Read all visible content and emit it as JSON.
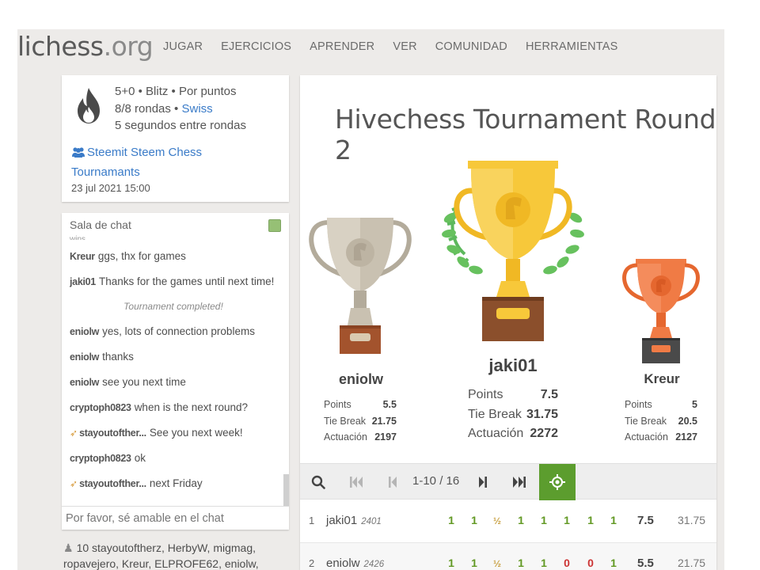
{
  "header": {
    "logo_main": "lichess",
    "logo_tld": ".org",
    "nav": [
      "JUGAR",
      "EJERCICIOS",
      "APRENDER",
      "VER",
      "COMUNIDAD",
      "HERRAMIENTAS"
    ]
  },
  "info": {
    "line1": "5+0 • Blitz • Por puntos",
    "line2_prefix": "8/8 rondas • ",
    "line2_link": "Swiss",
    "line3": "5 segundos entre rondas",
    "team": "Steemit Steem Chess Tournamants",
    "date": "23 jul 2021 15:00"
  },
  "chat": {
    "title": "Sala de chat",
    "cut_text": "wins",
    "messages": [
      {
        "user": "Kreur",
        "text": "ggs, thx for games"
      },
      {
        "user": "jaki01",
        "text": "Thanks for the games until next time!"
      },
      {
        "system": "Tournament completed!"
      },
      {
        "user": "eniolw",
        "text": "yes, lots of connection problems"
      },
      {
        "user": "eniolw",
        "text": "thanks"
      },
      {
        "user": "eniolw",
        "text": "see you next time"
      },
      {
        "user": "cryptoph0823",
        "text": "when is the next round?"
      },
      {
        "user": "stayoutofther...",
        "text": "See you next week!",
        "wing": true
      },
      {
        "user": "cryptoph0823",
        "text": "ok"
      },
      {
        "user": "stayoutofther...",
        "text": "next Friday",
        "wing": true
      }
    ],
    "placeholder": "Por favor, sé amable en el chat",
    "members_count": "10",
    "members": "stayoutoftherz, HerbyW, migmag, ropavejero, Kreur, ELPROFE62, eniolw,"
  },
  "tournament": {
    "title": "Hivechess Tournament Round 2",
    "podium": [
      {
        "place": 2,
        "name": "eniolw",
        "points": "5.5",
        "tiebreak": "21.75",
        "performance": "2197"
      },
      {
        "place": 1,
        "name": "jaki01",
        "points": "7.5",
        "tiebreak": "31.75",
        "performance": "2272"
      },
      {
        "place": 3,
        "name": "Kreur",
        "points": "5",
        "tiebreak": "20.5",
        "performance": "2127"
      }
    ],
    "labels": {
      "points": "Points",
      "tiebreak": "Tie Break",
      "performance": "Actuación"
    },
    "colors": {
      "gold": "#f7c83a",
      "silver": "#c9c1b1",
      "bronze": "#f07b45",
      "accent": "#5c9d2e"
    }
  },
  "controls": {
    "pager": "1-10 / 16"
  },
  "standings": [
    {
      "rank": "1",
      "name": "jaki01",
      "rating": "2401",
      "scores": [
        "1",
        "1",
        "½",
        "1",
        "1",
        "1",
        "1",
        "1"
      ],
      "points": "7.5",
      "tiebreak": "31.75"
    },
    {
      "rank": "2",
      "name": "eniolw",
      "rating": "2426",
      "scores": [
        "1",
        "1",
        "½",
        "1",
        "1",
        "0",
        "0",
        "1"
      ],
      "points": "5.5",
      "tiebreak": "21.75"
    }
  ]
}
